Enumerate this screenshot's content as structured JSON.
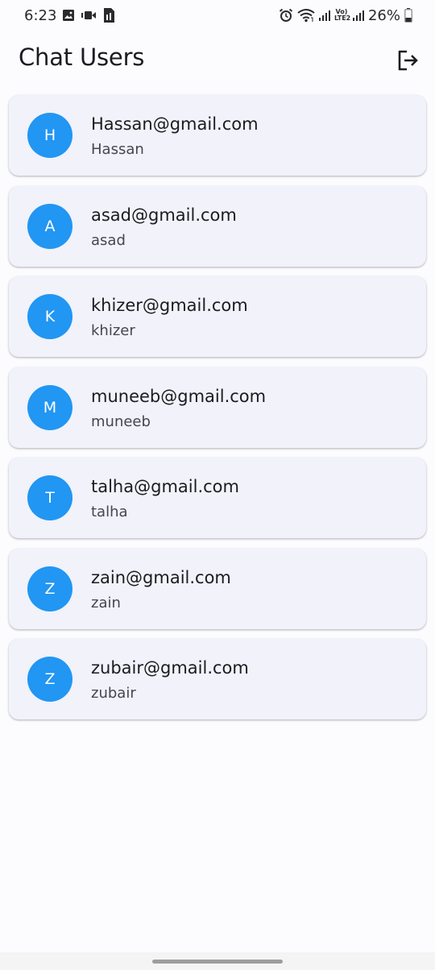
{
  "status_bar": {
    "time": "6:23",
    "battery": "26%",
    "volte_top": "Vo)",
    "volte_bottom": "LTE2"
  },
  "app_bar": {
    "title": "Chat Users",
    "logout_icon": "logout-icon"
  },
  "users": [
    {
      "initial": "H",
      "email": "Hassan@gmail.com",
      "name": "Hassan"
    },
    {
      "initial": "A",
      "email": "asad@gmail.com",
      "name": "asad"
    },
    {
      "initial": "K",
      "email": "khizer@gmail.com",
      "name": "khizer"
    },
    {
      "initial": "M",
      "email": "muneeb@gmail.com",
      "name": "muneeb"
    },
    {
      "initial": "T",
      "email": "talha@gmail.com",
      "name": "talha"
    },
    {
      "initial": "Z",
      "email": "zain@gmail.com",
      "name": "zain"
    },
    {
      "initial": "Z",
      "email": "zubair@gmail.com",
      "name": "zubair"
    }
  ],
  "colors": {
    "avatar": "#2196f3",
    "card": "#f1f2fa",
    "background": "#fcfcff"
  }
}
